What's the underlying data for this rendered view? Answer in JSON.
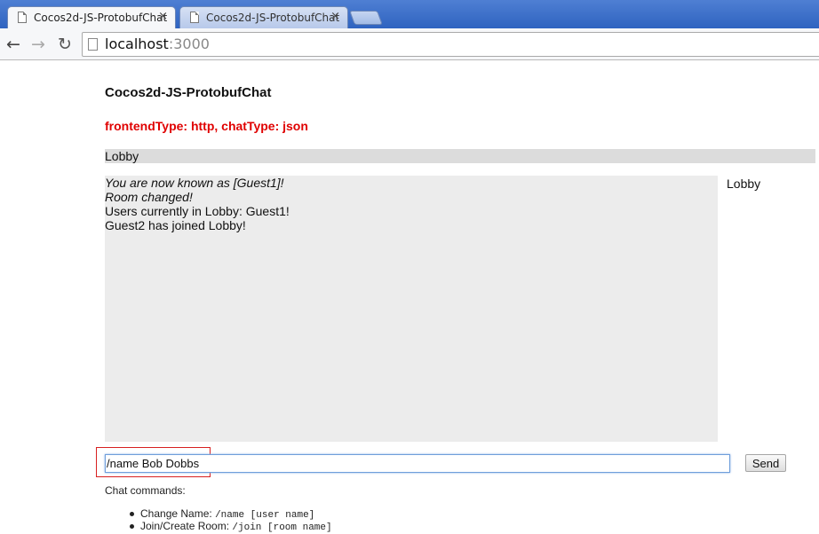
{
  "browser": {
    "tabs": [
      {
        "title": "Cocos2d-JS-ProtobufChat",
        "active": true,
        "icon": "page-icon"
      },
      {
        "title": "Cocos2d-JS-ProtobufChat",
        "active": false,
        "icon": "page-icon"
      }
    ],
    "close_glyph": "×",
    "url_host": "localhost",
    "url_port": ":3000"
  },
  "page": {
    "title": "Cocos2d-JS-ProtobufChat",
    "status": "frontendType: http, chatType: json",
    "current_room": "Lobby",
    "messages": [
      {
        "text": "You are now known as [Guest1]!",
        "system": true
      },
      {
        "text": "Room changed!",
        "system": true
      },
      {
        "text": "Users currently in Lobby: Guest1!",
        "system": false
      },
      {
        "text": "Guest2 has joined Lobby!",
        "system": false
      }
    ],
    "rooms": [
      "Lobby"
    ],
    "input_value": "/name Bob Dobbs",
    "send_label": "Send",
    "help_title": "Chat commands:",
    "commands": [
      {
        "label": "Change Name:",
        "syntax": "/name [user name]"
      },
      {
        "label": "Join/Create Room:",
        "syntax": "/join [room name]"
      }
    ]
  },
  "colors": {
    "status": "#e00000",
    "highlight_box": "#d72020",
    "message_bg": "#ececec",
    "room_bar_bg": "#dcdcdc"
  }
}
